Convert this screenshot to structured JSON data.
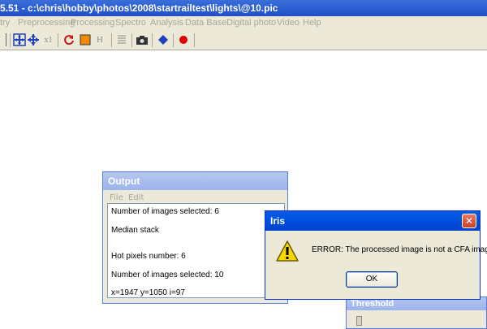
{
  "window": {
    "title": "5.51 - c:\\chris\\hobby\\photos\\2008\\startrailtest\\lights\\@10.pic"
  },
  "menu": [
    "try",
    "Preprocessing",
    "Processing",
    "Spectro",
    "Analysis",
    "Data Base",
    "Digital photo",
    "Video",
    "Help"
  ],
  "toolbar": {
    "icons": [
      "move-icon",
      "zoom-fit-icon",
      "zoom-pan-icon",
      "zoom-x1-icon",
      "refresh-icon",
      "color-square-icon",
      "histogram-icon",
      "list-icon",
      "camera-icon",
      "diamond-icon",
      "record-icon"
    ],
    "x1_label": "x1",
    "h_label": "H"
  },
  "output": {
    "title": "Output",
    "menu_file": "File",
    "menu_edit": "Edit",
    "lines": [
      "Number of images selected: 6",
      "Median stack",
      "Hot pixels number: 6",
      "Number of images selected: 10",
      "x=1947  y=1050  i=97"
    ]
  },
  "threshold": {
    "title": "Threshold"
  },
  "dialog": {
    "title": "Iris",
    "message": "ERROR: The processed image is not a CFA image",
    "ok_label": "OK"
  },
  "colors": {
    "titlebar": "#2a5bd0",
    "chrome": "#ece9d8",
    "inactive_caption": "#9db3ea"
  }
}
